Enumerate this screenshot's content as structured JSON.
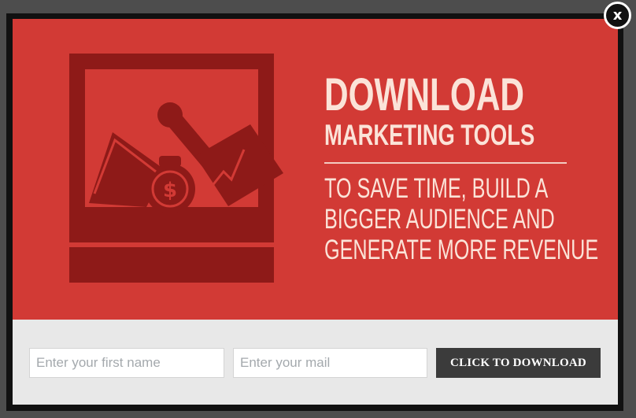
{
  "popup": {
    "headline_main": "DOWNLOAD",
    "headline_sub": "MARKETING TOOLS",
    "body_lines": [
      "TO SAVE TIME, BUILD A",
      "BIGGER AUDIENCE AND",
      "GENERATE MORE REVENUE"
    ],
    "illustration_icons": [
      "toolbox-icon",
      "wrench-icon",
      "money-bag-icon",
      "envelope-icon",
      "growth-chart-icon"
    ]
  },
  "form": {
    "first_name_placeholder": "Enter your first name",
    "email_placeholder": "Enter your mail",
    "submit_label": "CLICK TO DOWNLOAD"
  },
  "close": {
    "label": "x"
  },
  "colors": {
    "backdrop": "#4d4d4d",
    "hero_red": "#d23a35",
    "illustration_dark_red": "#8e1a18",
    "headline_text": "#fbe3d8",
    "form_bar": "#e8e8e8",
    "button_dark": "#3b3b3b"
  }
}
